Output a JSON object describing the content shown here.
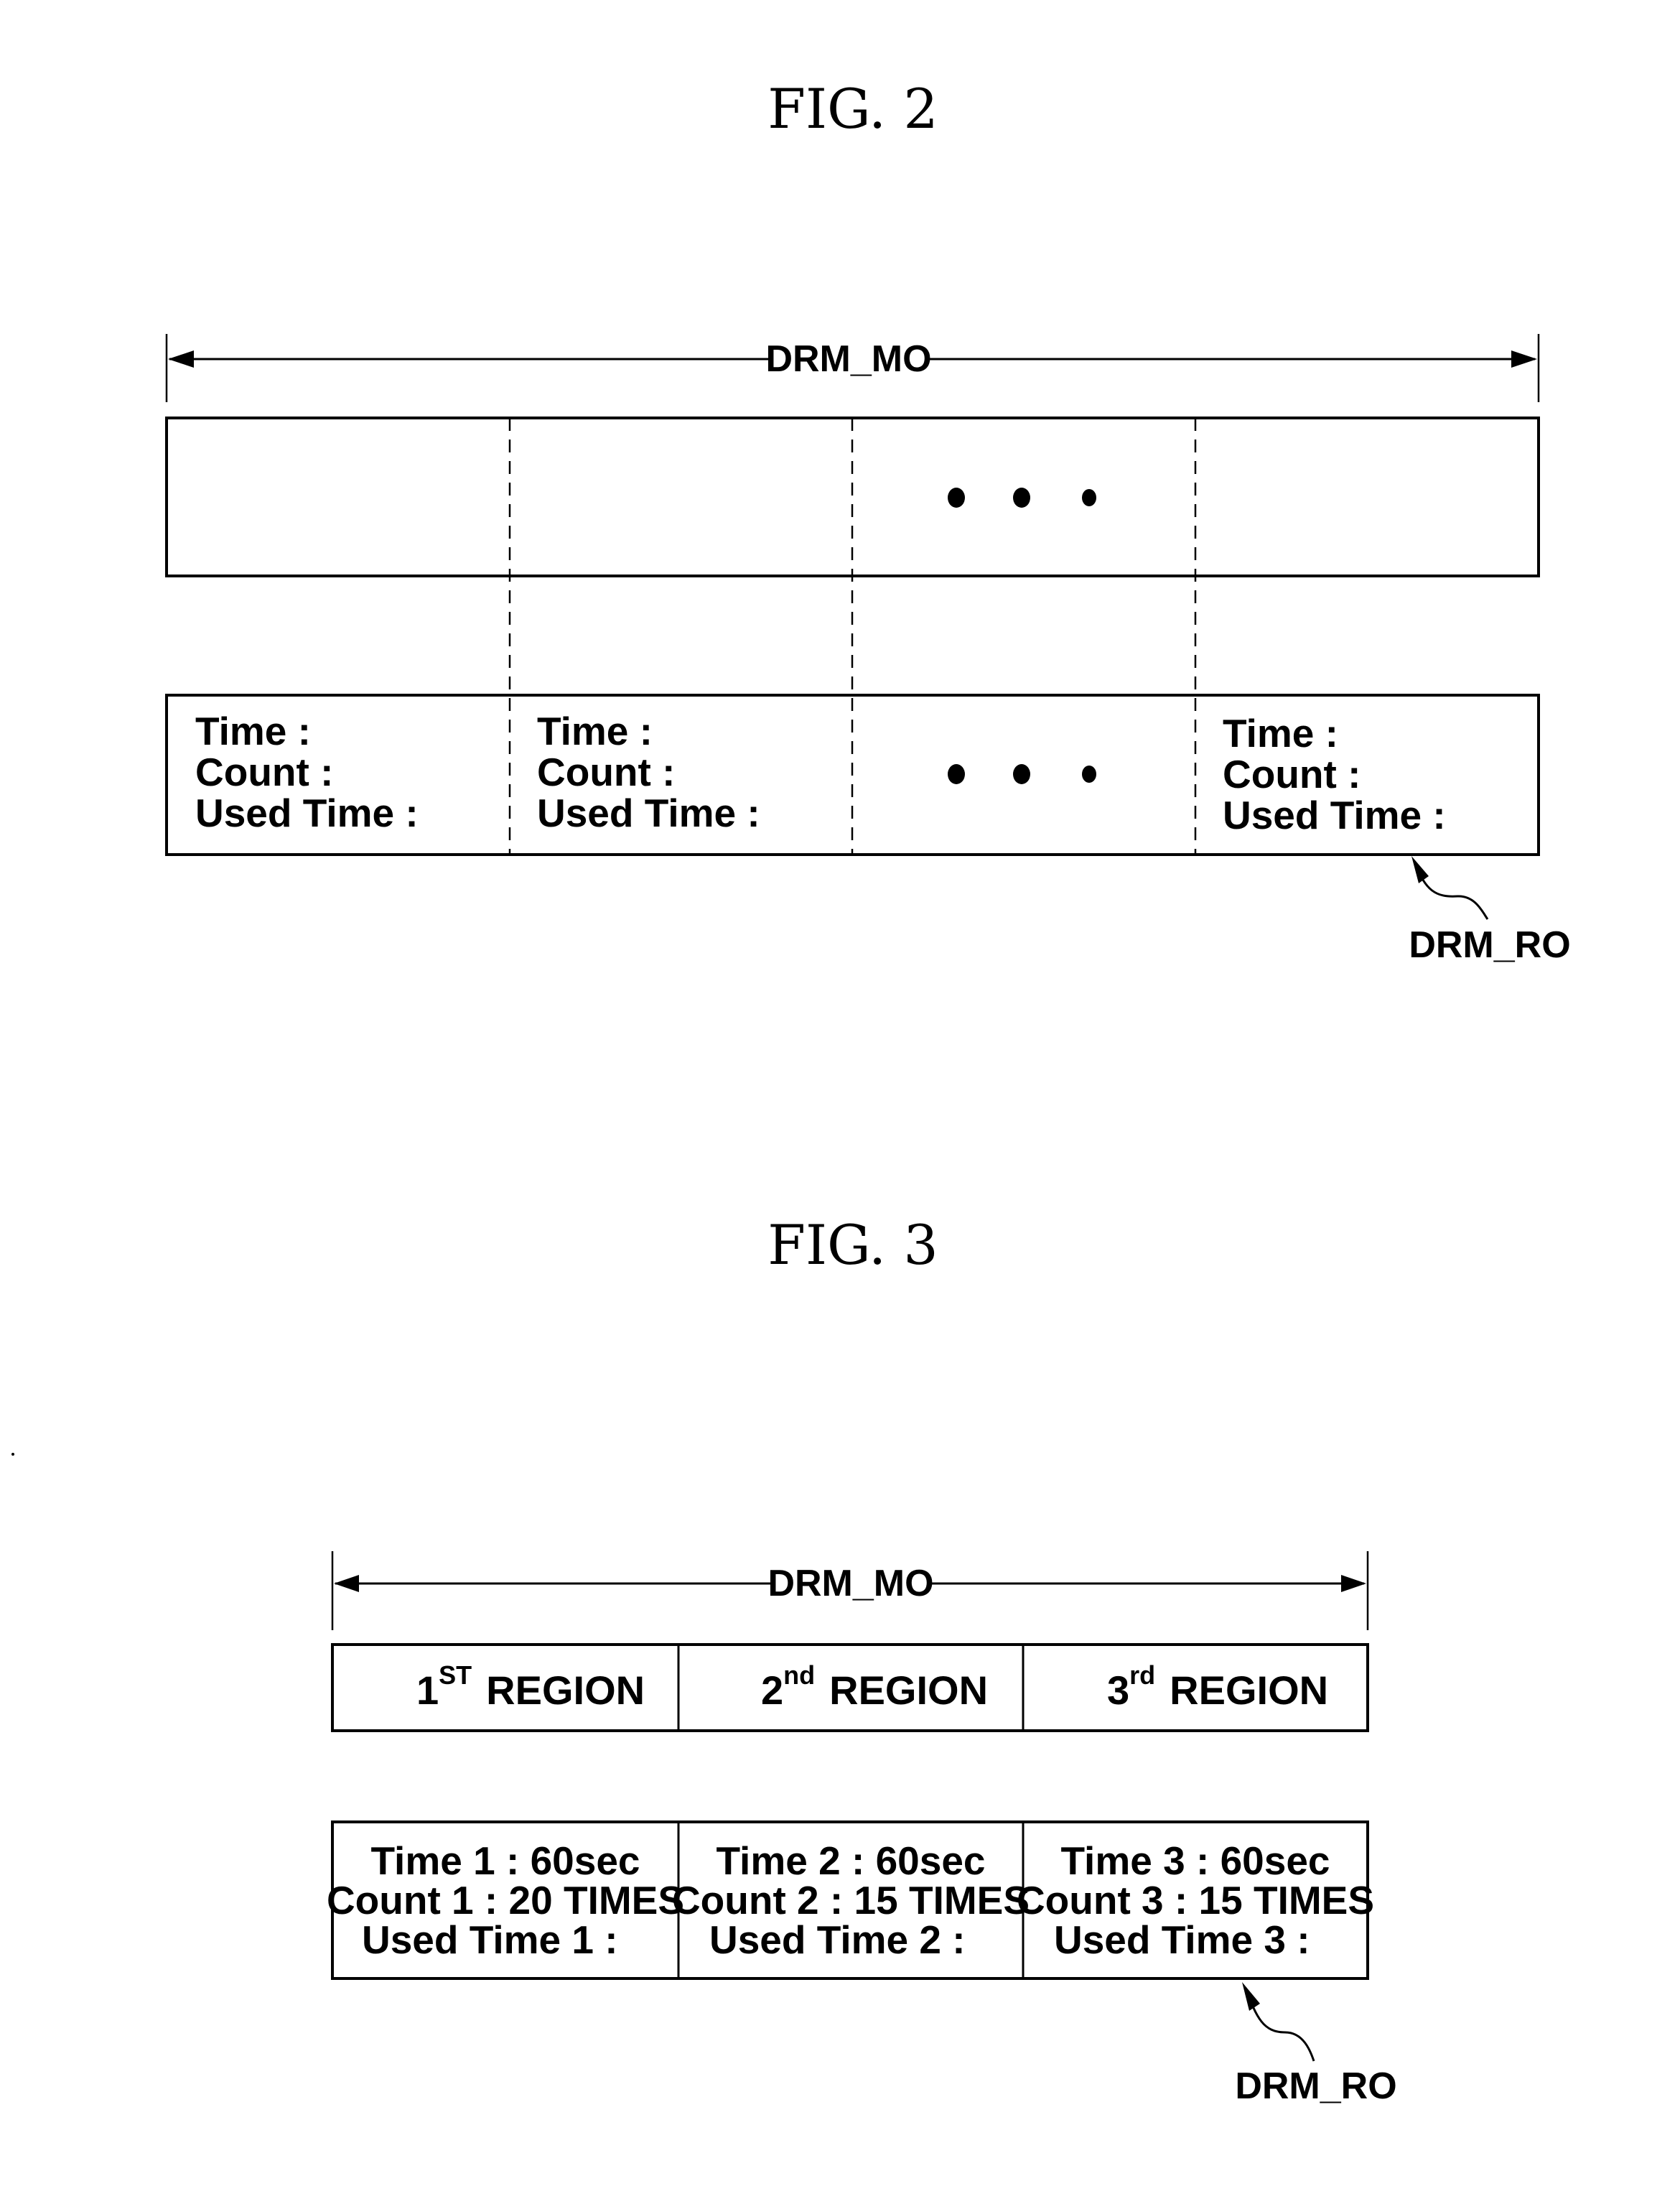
{
  "fig2": {
    "title": "FIG. 2",
    "span_label": "DRM_MO",
    "callout_label": "DRM_RO",
    "ellipsis": "• • •",
    "fields": [
      {
        "time": "Time :",
        "count": "Count :",
        "used": "Used Time :"
      },
      {
        "time": "Time :",
        "count": "Count :",
        "used": "Used Time :"
      },
      {
        "time": "Time :",
        "count": "Count :",
        "used": "Used Time :"
      }
    ]
  },
  "fig3": {
    "title": "FIG. 3",
    "span_label": "DRM_MO",
    "callout_label": "DRM_RO",
    "regions": [
      {
        "num": "1",
        "sup": "ST",
        "word": "REGION"
      },
      {
        "num": "2",
        "sup": "nd",
        "word": "REGION"
      },
      {
        "num": "3",
        "sup": "rd",
        "word": "REGION"
      }
    ],
    "fields": [
      {
        "time": "Time 1 : 60sec",
        "count": "Count 1 : 20 TIMES",
        "used": "Used Time 1 :"
      },
      {
        "time": "Time 2 : 60sec",
        "count": "Count 2 : 15 TIMES",
        "used": "Used Time 2 :"
      },
      {
        "time": "Time 3 : 60sec",
        "count": "Count 3 : 15 TIMES",
        "used": "Used Time 3 :"
      }
    ]
  }
}
